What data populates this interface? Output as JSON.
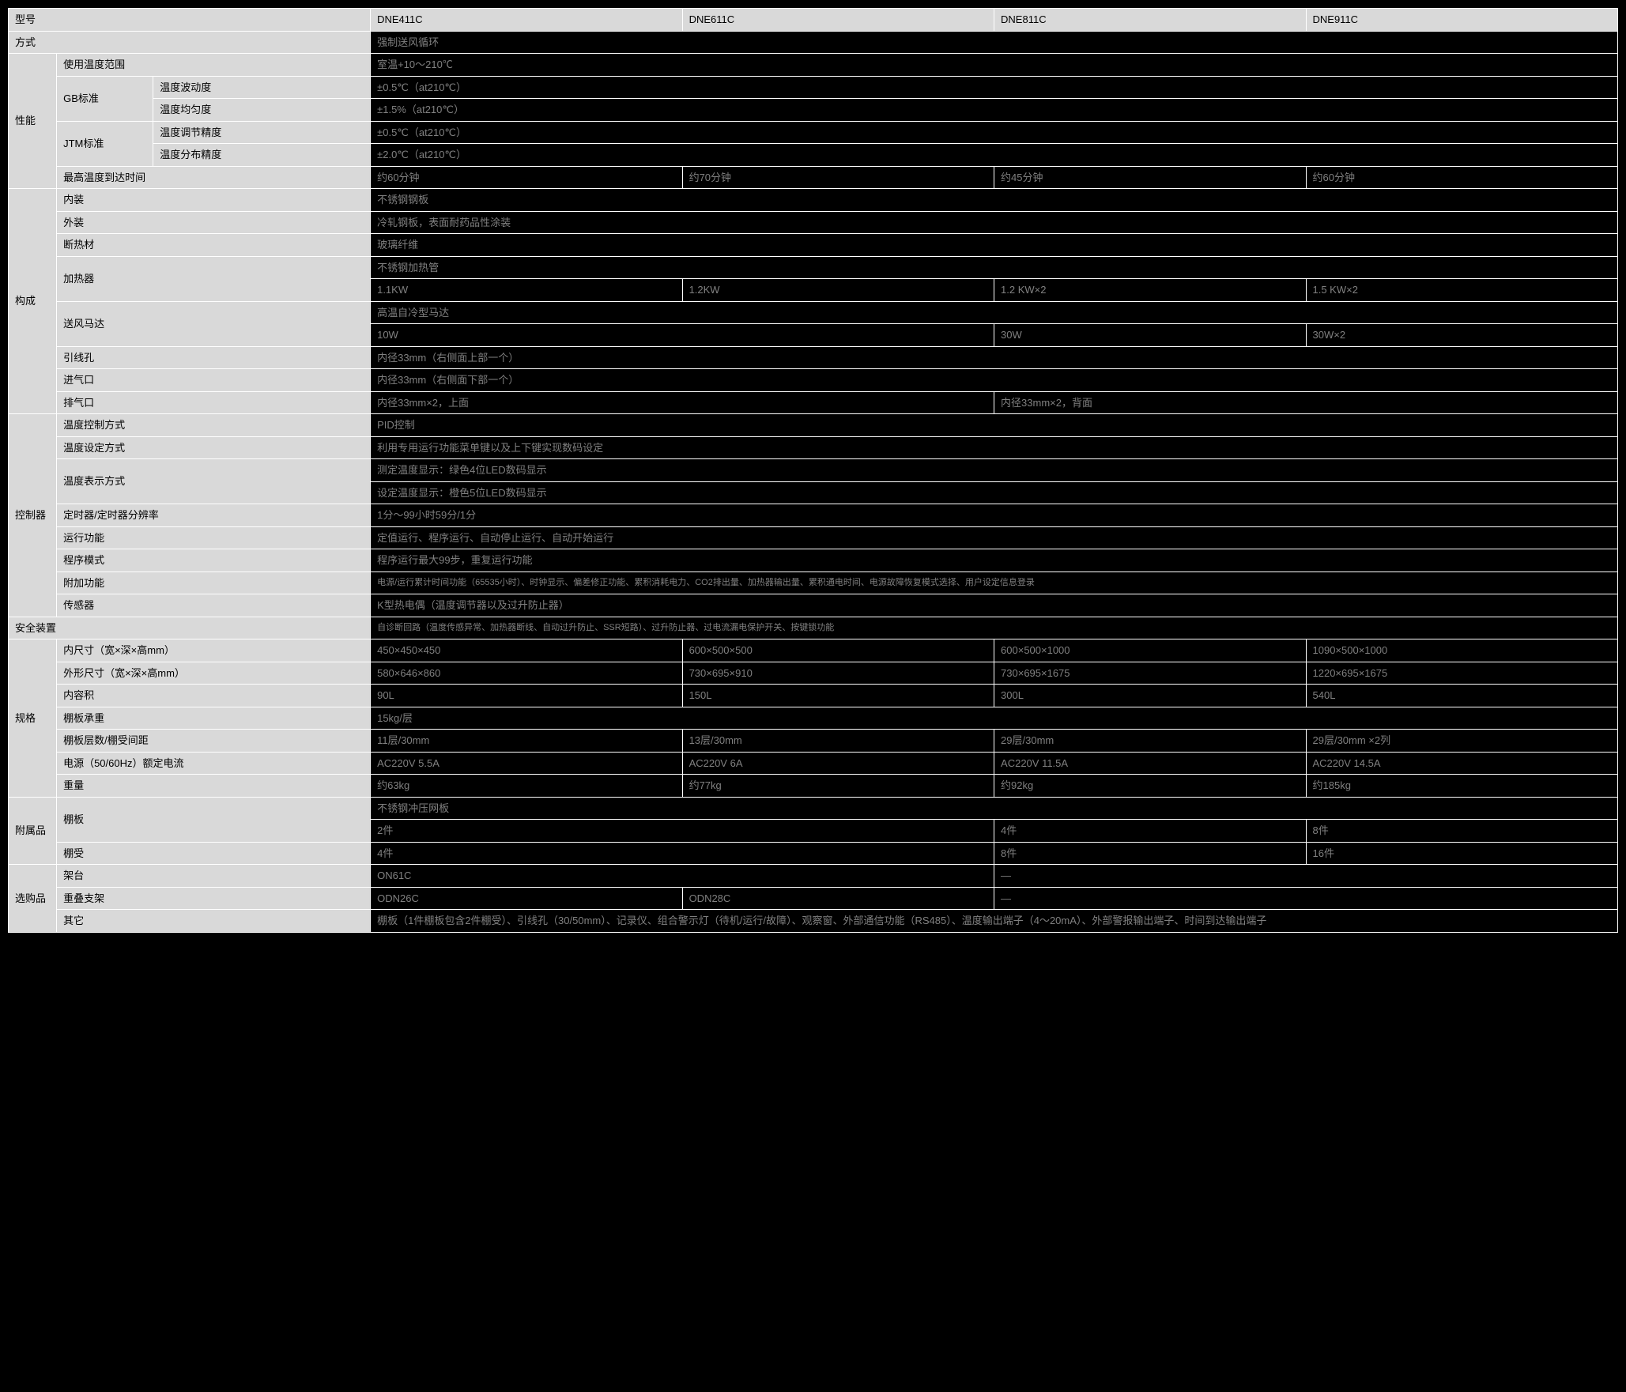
{
  "headers": {
    "model": "型号",
    "m1": "DNE411C",
    "m2": "DNE611C",
    "m3": "DNE811C",
    "m4": "DNE911C"
  },
  "method": {
    "label": "方式",
    "value": "强制送风循环"
  },
  "perf": {
    "group": "性能",
    "temp_range": {
      "label": "使用温度范围",
      "value": "室温+10～210℃"
    },
    "gb": {
      "label": "GB标准",
      "fluct": {
        "label": "温度波动度",
        "value": "±0.5℃（at210℃）"
      },
      "unif": {
        "label": "温度均匀度",
        "value": "±1.5%（at210℃）"
      }
    },
    "jtm": {
      "label": "JTM标准",
      "adj": {
        "label": "温度调节精度",
        "value": "±0.5℃（at210℃）"
      },
      "dist": {
        "label": "温度分布精度",
        "value": "±2.0℃（at210℃）"
      }
    },
    "reach": {
      "label": "最高温度到达时间",
      "v1": "约60分钟",
      "v2": "约70分钟",
      "v3": "约45分钟",
      "v4": "约60分钟"
    }
  },
  "struct": {
    "group": "构成",
    "inner": {
      "label": "内装",
      "value": "不锈钢钢板"
    },
    "outer": {
      "label": "外装",
      "value": "冷轧钢板，表面耐药品性涂装"
    },
    "insul": {
      "label": "断热材",
      "value": "玻璃纤维"
    },
    "heater": {
      "label": "加热器",
      "top": "不锈钢加热管",
      "v1": "1.1KW",
      "v2": "1.2KW",
      "v3": "1.2 KW×2",
      "v4": "1.5 KW×2"
    },
    "fan": {
      "label": "送风马达",
      "top": "高温自冷型马达",
      "v12": "10W",
      "v3": "30W",
      "v4": "30W×2"
    },
    "cable": {
      "label": "引线孔",
      "value": "内径33mm（右侧面上部一个）"
    },
    "intake": {
      "label": "进气口",
      "value": "内径33mm（右侧面下部一个）"
    },
    "exhaust": {
      "label": "排气口",
      "v12": "内径33mm×2，上面",
      "v34": "内径33mm×2，背面"
    }
  },
  "ctrl": {
    "group": "控制器",
    "tcmode": {
      "label": "温度控制方式",
      "value": "PID控制"
    },
    "tset": {
      "label": "温度设定方式",
      "value": "利用专用运行功能菜单键以及上下键实现数码设定"
    },
    "tdisp": {
      "label": "温度表示方式",
      "r1": "测定温度显示：绿色4位LED数码显示",
      "r2": "设定温度显示：橙色5位LED数码显示"
    },
    "timer": {
      "label": "定时器/定时器分辨率",
      "value": "1分～99小时59分/1分"
    },
    "run": {
      "label": "运行功能",
      "value": "定值运行、程序运行、自动停止运行、自动开始运行"
    },
    "prog": {
      "label": "程序模式",
      "value": "程序运行最大99步，重复运行功能"
    },
    "extra": {
      "label": "附加功能",
      "value": "电源/运行累计时间功能（65535小时）、时钟显示、偏差修正功能、累积消耗电力、CO2排出量、加热器输出量、累积通电时间、电源故障恢复模式选择、用户设定信息登录"
    },
    "sensor": {
      "label": "传感器",
      "value": "K型热电偶（温度调节器以及过升防止器）"
    }
  },
  "safety": {
    "label": "安全装置",
    "value": "自诊断回路（温度传感异常、加热器断线、自动过升防止、SSR短路）、过升防止器、过电流漏电保护开关、按键锁功能"
  },
  "spec": {
    "group": "规格",
    "inner": {
      "label": "内尺寸（宽×深×高mm）",
      "v1": "450×450×450",
      "v2": "600×500×500",
      "v3": "600×500×1000",
      "v4": "1090×500×1000"
    },
    "outer": {
      "label": "外形尺寸（宽×深×高mm）",
      "v1": "580×646×860",
      "v2": "730×695×910",
      "v3": "730×695×1675",
      "v4": "1220×695×1675"
    },
    "vol": {
      "label": "内容积",
      "v1": "90L",
      "v2": "150L",
      "v3": "300L",
      "v4": "540L"
    },
    "load": {
      "label": "棚板承重",
      "value": "15kg/层"
    },
    "layers": {
      "label": "棚板层数/棚受间距",
      "v1": "11层/30mm",
      "v2": "13层/30mm",
      "v3": "29层/30mm",
      "v4": "29层/30mm ×2列"
    },
    "power": {
      "label": "电源（50/60Hz）额定电流",
      "v1": "AC220V 5.5A",
      "v2": "AC220V 6A",
      "v3": "AC220V 11.5A",
      "v4": "AC220V 14.5A"
    },
    "weight": {
      "label": "重量",
      "v1": "约63kg",
      "v2": "约77kg",
      "v3": "约92kg",
      "v4": "约185kg"
    }
  },
  "acc": {
    "group": "附属品",
    "shelf": {
      "label": "棚板",
      "top": "不锈钢冲压网板",
      "v12": "2件",
      "v3": "4件",
      "v4": "8件"
    },
    "holder": {
      "label": "棚受",
      "v12": "4件",
      "v3": "8件",
      "v4": "16件"
    }
  },
  "opt": {
    "group": "选购品",
    "stand": {
      "label": "架台",
      "v12": "ON61C",
      "v34": "—"
    },
    "stack": {
      "label": "重叠支架",
      "v1": "ODN26C",
      "v2": "ODN28C",
      "v34": "—"
    },
    "other": {
      "label": "其它",
      "value": "棚板（1件棚板包含2件棚受）、引线孔（30/50mm）、记录仪、组合警示灯（待机/运行/故障）、观察窗、外部通信功能（RS485）、温度输出端子（4～20mA）、外部警报输出端子、时间到达输出端子"
    }
  }
}
